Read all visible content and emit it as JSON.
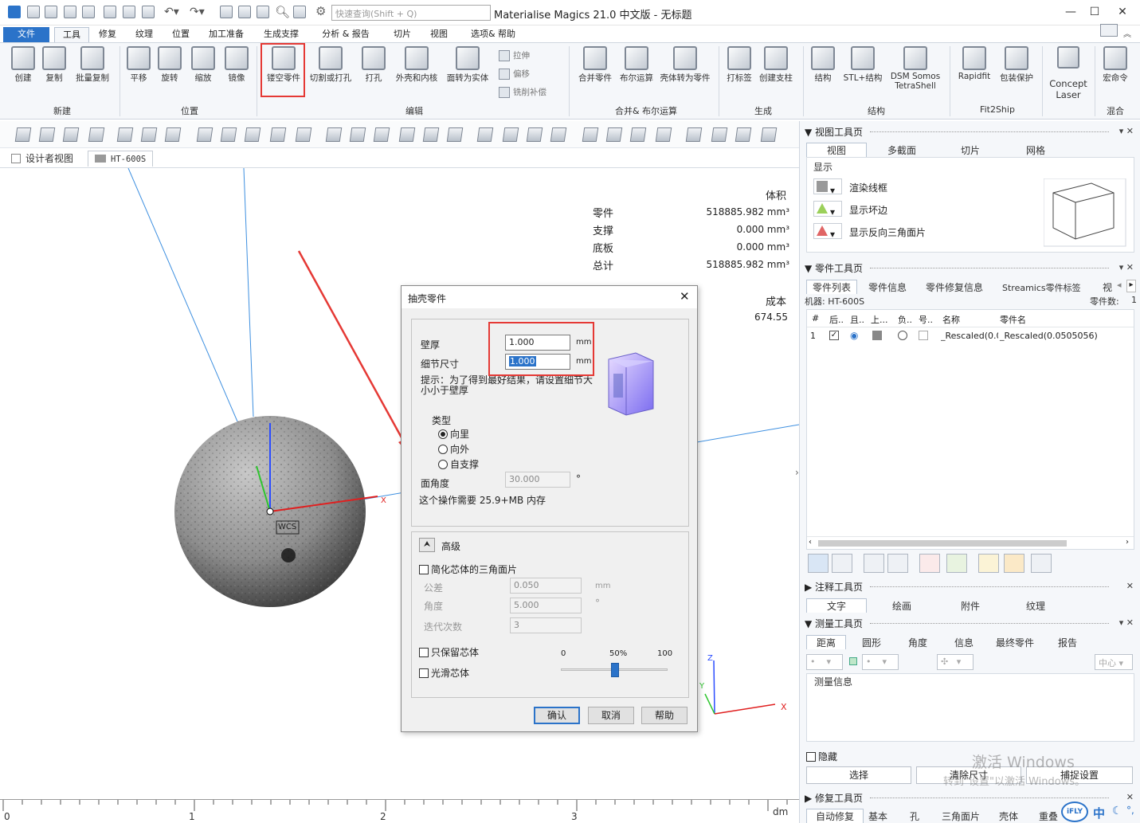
{
  "window": {
    "search_placeholder": "快速查询(Shift + Q)",
    "title": "Materialise Magics 21.0 中文版 - 无标题"
  },
  "menu": {
    "tabs": [
      "文件",
      "工具",
      "修复",
      "纹理",
      "位置",
      "加工准备",
      "生成支撑",
      "分析 & 报告",
      "切片",
      "视图",
      "选项& 帮助"
    ],
    "active": "工具"
  },
  "ribbon": {
    "buttons": [
      "创建",
      "复制",
      "批量复制",
      "平移",
      "旋转",
      "缩放",
      "镜像",
      "镂空零件",
      "切割或打孔",
      "打孔",
      "外壳和内核",
      "面转为实体",
      "合并零件",
      "布尔运算",
      "壳体转为零件",
      "打标签",
      "创建支柱",
      "结构",
      "STL+结构",
      "DSM Somos",
      "Rapidfit",
      "包装保护",
      "Concept",
      "宏命令"
    ],
    "dsm_sub": "TetraShell",
    "concept_sub": "Laser",
    "small_buttons": [
      "拉伸",
      "偏移",
      "铣削补偿"
    ],
    "groups": [
      "新建",
      "位置",
      "编辑",
      "合并& 布尔运算",
      "生成",
      "结构",
      "Fit2Ship",
      "混合"
    ]
  },
  "viewtabs": {
    "designer": "设计者视图",
    "machine": "HT-600S"
  },
  "stats": {
    "volume_header": "体积",
    "rows": [
      {
        "label": "零件",
        "value": "518885.982 mm³"
      },
      {
        "label": "支撑",
        "value": "0.000 mm³"
      },
      {
        "label": "底板",
        "value": "0.000 mm³"
      },
      {
        "label": "总计",
        "value": "518885.982 mm³"
      }
    ],
    "cost_header": "成本",
    "cost_value": "674.55"
  },
  "viewport": {
    "wcs_label": "WCS",
    "axis_x": "X",
    "axis_y": "Y",
    "axis_z": "Z",
    "ruler": [
      "0",
      "1",
      "2",
      "3"
    ],
    "ruler_unit": "dm"
  },
  "dialog": {
    "title": "抽壳零件",
    "wall_label": "壁厚",
    "wall_value": "1.000",
    "detail_label": "细节尺寸",
    "detail_value": "1.000",
    "unit_mm": "mm",
    "hint": "提示：为了得到最好结果，请设置细节大小小于壁厚",
    "type_label": "类型",
    "type_options": [
      "向里",
      "向外",
      "自支撑"
    ],
    "type_selected": 0,
    "face_angle_label": "面角度",
    "face_angle_value": "30.000",
    "degree": "°",
    "memory": "这个操作需要 25.9+MB 内存",
    "advanced": "高级",
    "simplify": "简化芯体的三角面片",
    "tolerance_label": "公差",
    "tolerance_value": "0.050",
    "angle_label": "角度",
    "angle_value": "5.000",
    "iter_label": "迭代次数",
    "iter_value": "3",
    "keep_core": "只保留芯体",
    "smooth_core": "光滑芯体",
    "slider_min": "0",
    "slider_mid": "50%",
    "slider_max": "100",
    "slider_value": 50,
    "ok": "确认",
    "cancel": "取消",
    "help": "帮助"
  },
  "right_panel": {
    "view_toolpage": {
      "title": "视图工具页",
      "tabs": [
        "视图",
        "多截面",
        "切片",
        "网格"
      ],
      "section": "显示",
      "items": [
        "渲染线框",
        "显示坏边",
        "显示反向三角面片"
      ]
    },
    "part_toolpage": {
      "title": "零件工具页",
      "tabs": [
        "零件列表",
        "零件信息",
        "零件修复信息",
        "Streamics零件标签",
        "视"
      ],
      "machine": "机器: HT-600S",
      "count_label": "零件数:",
      "count": "1",
      "columns": [
        "#",
        "后..",
        "且..",
        "上...",
        "负..",
        "号..",
        "名称",
        "零件名"
      ],
      "row": {
        "num": "1",
        "name": "_Rescaled(0.0",
        "part_name": "_Rescaled(0.0505056)"
      }
    },
    "annotation_toolpage": {
      "title": "注释工具页",
      "tabs": [
        "文字",
        "绘画",
        "附件",
        "纹理"
      ]
    },
    "measure_toolpage": {
      "title": "测量工具页",
      "tabs": [
        "距离",
        "圆形",
        "角度",
        "信息",
        "最终零件",
        "报告"
      ],
      "center": "中心",
      "info_label": "测量信息",
      "hide": "隐藏",
      "select": "选择",
      "clear": "清除尺寸",
      "snap": "捕捉设置"
    },
    "repair_toolpage": {
      "title": "修复工具页",
      "tabs": [
        "自动修复",
        "基本",
        "孔",
        "三角面片",
        "壳体",
        "重叠"
      ]
    },
    "watermark_1": "激活 Windows",
    "watermark_2": "转到\"设置\"以激活 Windows。",
    "ime": "中"
  }
}
